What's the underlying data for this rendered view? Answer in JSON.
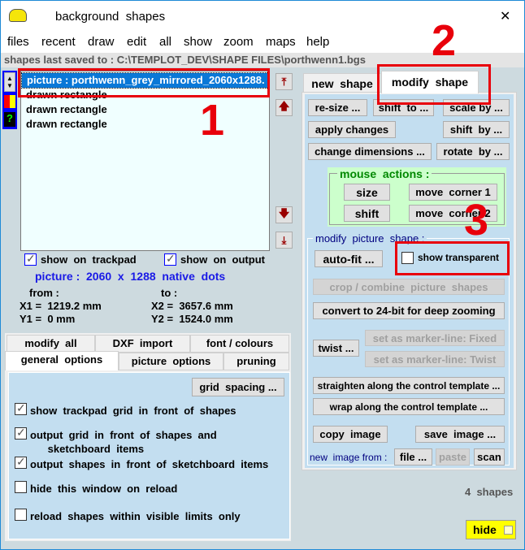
{
  "window": {
    "title": "background  shapes",
    "close": "✕"
  },
  "menu": [
    "files",
    "recent",
    "draw",
    "edit",
    "all",
    "show",
    "zoom",
    "maps",
    "help"
  ],
  "path": "shapes last saved to :  C:\\TEMPLOT_DEV\\SHAPE FILES\\porthwenn1.bgs",
  "list": [
    "picture : porthwenn_grey_mirrored_2060x1288.",
    "drawn rectangle",
    "drawn rectangle",
    "drawn rectangle"
  ],
  "show_trackpad": "show  on  trackpad",
  "show_output": "show  on  output",
  "picture_info": "picture :  2060  x  1288  native  dots",
  "from_label": "from :",
  "to_label": "to :",
  "x1": "X1 =  1219.2 mm",
  "y1": "Y1 =  0 mm",
  "x2": "X2 =  3657.6 mm",
  "y2": "Y2 =  1524.0 mm",
  "lower_tabs_row1": [
    "modify  all",
    "DXF  import",
    "font / colours"
  ],
  "lower_tabs_row2": [
    "general  options",
    "picture  options",
    "pruning"
  ],
  "grid_spacing": "grid  spacing ...",
  "options": [
    "show  trackpad  grid  in  front  of  shapes",
    "output  grid  in  front  of  shapes  and\n      sketchboard  items",
    "output  shapes  in  front  of  sketchboard  items",
    "hide  this  window  on  reload",
    "reload  shapes  within  visible  limits  only"
  ],
  "options_checked": [
    true,
    true,
    true,
    false,
    false
  ],
  "right_tabs": [
    "new  shape",
    "modify  shape"
  ],
  "buttons": {
    "resize": "re-size ...",
    "shift_to": "shift  to ...",
    "scale_by": "scale by ...",
    "apply": "apply changes",
    "shift_by": "shift  by ...",
    "change_dim": "change dimensions ...",
    "rotate_by": "rotate  by ..."
  },
  "mouse_actions": {
    "title": "mouse  actions :",
    "size": "size",
    "shift": "shift",
    "corner1": "move  corner 1",
    "corner2": "move  corner 2"
  },
  "picture_shape": {
    "title": "modify  picture  shape :",
    "autofit": "auto-fit ...",
    "show_transparent": "show transparent",
    "crop": "crop / combine  picture  shapes",
    "convert": "convert to 24-bit for deep zooming",
    "twist": "twist ...",
    "marker_fixed": "set as marker-line: Fixed",
    "marker_twist": "set as marker-line: Twist",
    "straighten": "straighten along the control template ...",
    "wrap": "wrap along the control template ...",
    "copy": "copy  image",
    "save": "save  image ...",
    "new_from": "new  image from :",
    "file": "file ...",
    "paste": "paste",
    "scan": "scan"
  },
  "count": "4  shapes",
  "hide": "hide",
  "annotations": [
    "1",
    "2",
    "3"
  ]
}
